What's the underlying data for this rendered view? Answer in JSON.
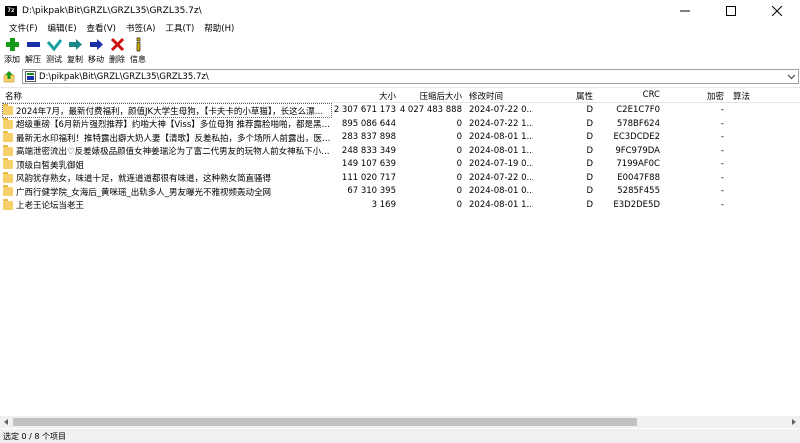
{
  "window": {
    "app_icon_text": "7z",
    "title": "D:\\pikpak\\Bit\\GRZL\\GRZL35\\GRZL35.7z\\"
  },
  "menu": [
    "文件(F)",
    "编辑(E)",
    "查看(V)",
    "书签(A)",
    "工具(T)",
    "帮助(H)"
  ],
  "toolbar": [
    {
      "label": "添加",
      "icon": "add-icon",
      "color": "#1a9a1a"
    },
    {
      "label": "解压",
      "icon": "extract-icon",
      "color": "#1b2fa8"
    },
    {
      "label": "测试",
      "icon": "test-icon",
      "color": "#1aa0a0"
    },
    {
      "label": "复制",
      "icon": "copy-icon",
      "color": "#1a8a8a"
    },
    {
      "label": "移动",
      "icon": "move-icon",
      "color": "#1b2fa8"
    },
    {
      "label": "删除",
      "icon": "delete-icon",
      "color": "#d01010"
    },
    {
      "label": "信息",
      "icon": "info-icon",
      "color": "#d8b000"
    }
  ],
  "address": {
    "path": "D:\\pikpak\\Bit\\GRZL\\GRZL35\\GRZL35.7z\\"
  },
  "columns": {
    "name": "名称",
    "size": "大小",
    "packed": "压缩后大小",
    "modified": "修改时间",
    "attr": "属性",
    "crc": "CRC",
    "encrypted": "加密",
    "method": "算法"
  },
  "rows": [
    {
      "name": "2024年7月，最新付费福利，颜值JK大学生母狗，【卡夫卡的小草猫】，长这么漂亮，直...",
      "size": "2 307 671 173",
      "packed": "4 027 483 888",
      "modified": "2024-07-22 0...",
      "attr": "D",
      "crc": "C2E1C7F0",
      "encrypted": "-"
    },
    {
      "name": "超级重磅【6月新片强烈推荐】约啪大神【Viss】多位母狗 推荐露脸啪啪，都是黑丝长腿...",
      "size": "895 086 644",
      "packed": "0",
      "modified": "2024-07-22 1...",
      "attr": "D",
      "crc": "578BF624",
      "encrypted": "-"
    },
    {
      "name": "最新无水印福利！推特露出癖大奶人妻【清歌】反差私拍，多个场所人前露出，医院超市...",
      "size": "283 837 898",
      "packed": "0",
      "modified": "2024-08-01 1...",
      "attr": "D",
      "crc": "EC3DCDE2",
      "encrypted": "-"
    },
    {
      "name": "高端泄密流出♡反差婊极品颜值女神姜瑞沦为了富二代男友的玩物人前女神私下小贱狗跪...",
      "size": "248 833 349",
      "packed": "0",
      "modified": "2024-08-01 1...",
      "attr": "D",
      "crc": "9FC979DA",
      "encrypted": "-"
    },
    {
      "name": "顶级白皙美乳御姐",
      "size": "149 107 639",
      "packed": "0",
      "modified": "2024-07-19 0...",
      "attr": "D",
      "crc": "7199AF0C",
      "encrypted": "-"
    },
    {
      "name": "风韵犹存熟女，味道十足，就连道道都很有味道，这种熟女简直骚得",
      "size": "111 020 717",
      "packed": "0",
      "modified": "2024-07-22 0...",
      "attr": "D",
      "crc": "E0047F88",
      "encrypted": "-"
    },
    {
      "name": "广西行健学院_女海后_黄咪瑶_出轨多人_男友曝光不雅视频轰动全网",
      "size": "67 310 395",
      "packed": "0",
      "modified": "2024-08-01 0...",
      "attr": "D",
      "crc": "5285F455",
      "encrypted": "-"
    },
    {
      "name": "上老王论坛当老王",
      "size": "3 169",
      "packed": "0",
      "modified": "2024-08-01 1...",
      "attr": "D",
      "crc": "E3D2DE5D",
      "encrypted": "-"
    }
  ],
  "status": {
    "text": "选定 0 / 8 个项目"
  }
}
